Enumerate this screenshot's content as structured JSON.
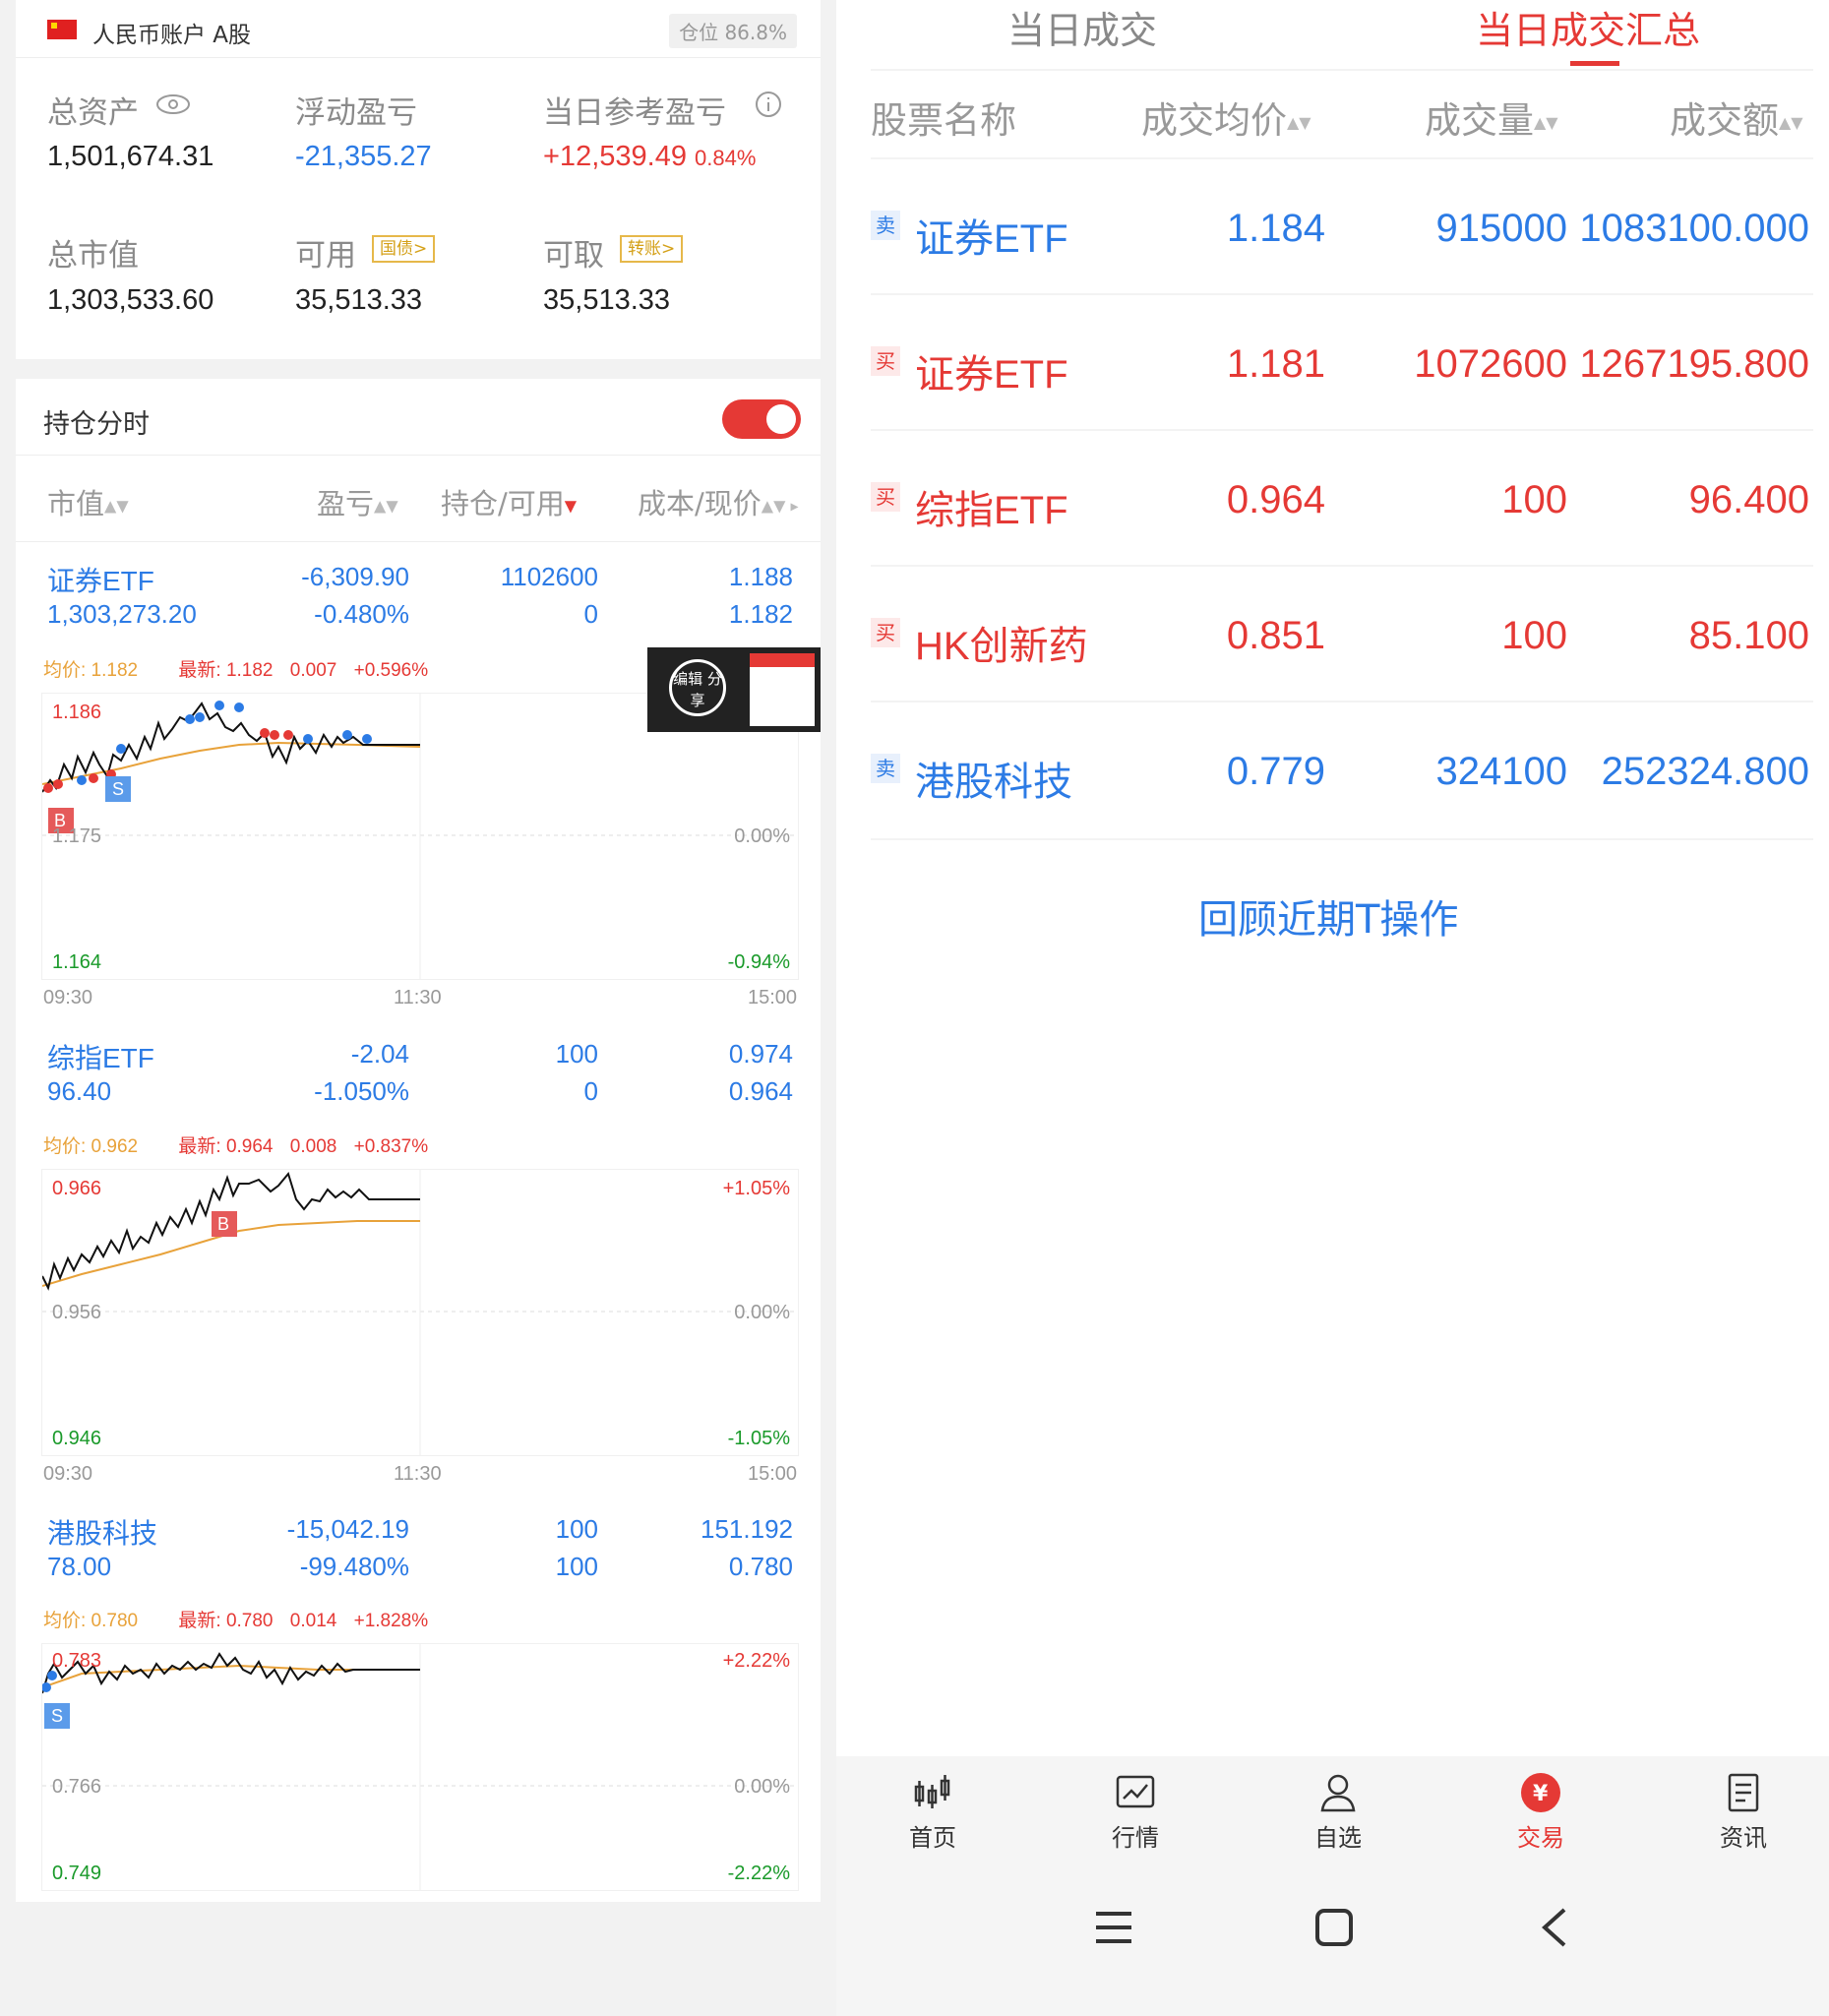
{
  "account": {
    "name": "人民币账户 A股",
    "position_label": "仓位 86.8%",
    "total_assets_label": "总资产",
    "total_assets": "1,501,674.31",
    "floating_pl_label": "浮动盈亏",
    "floating_pl": "-21,355.27",
    "daily_pl_label": "当日参考盈亏",
    "daily_pl": "+12,539.49",
    "daily_pl_pct": "0.84%",
    "market_value_label": "总市值",
    "market_value": "1,303,533.60",
    "available_label": "可用",
    "available_tag": "国债>",
    "available": "35,513.33",
    "withdrawable_label": "可取",
    "withdrawable_tag": "转账>",
    "withdrawable": "35,513.33"
  },
  "holdings_section": {
    "title": "持仓分时",
    "toggle_on": true,
    "headers": [
      "市值",
      "盈亏",
      "持仓/可用",
      "成本/现价"
    ]
  },
  "holdings": [
    {
      "name": "证券ETF",
      "market_value": "1,303,273.20",
      "pl": "-6,309.90",
      "pl_pct": "-0.480%",
      "position": "1102600",
      "available": "0",
      "cost": "1.188",
      "price": "1.182",
      "avg_label": "均价: 1.182",
      "last_label": "最新: 1.182",
      "change": "0.007",
      "change_pct": "+0.596%",
      "axis_top": "1.186",
      "axis_mid": "1.175",
      "axis_low": "1.164",
      "pct_top": "",
      "pct_mid": "0.00%",
      "pct_low": "-0.94%",
      "times": [
        "09:30",
        "11:30",
        "15:00"
      ]
    },
    {
      "name": "综指ETF",
      "market_value": "96.40",
      "pl": "-2.04",
      "pl_pct": "-1.050%",
      "position": "100",
      "available": "0",
      "cost": "0.974",
      "price": "0.964",
      "avg_label": "均价: 0.962",
      "last_label": "最新: 0.964",
      "change": "0.008",
      "change_pct": "+0.837%",
      "axis_top": "0.966",
      "axis_mid": "0.956",
      "axis_low": "0.946",
      "pct_top": "+1.05%",
      "pct_mid": "0.00%",
      "pct_low": "-1.05%",
      "times": [
        "09:30",
        "11:30",
        "15:00"
      ]
    },
    {
      "name": "港股科技",
      "market_value": "78.00",
      "pl": "-15,042.19",
      "pl_pct": "-99.480%",
      "position": "100",
      "available": "100",
      "cost": "151.192",
      "price": "0.780",
      "avg_label": "均价: 0.780",
      "last_label": "最新: 0.780",
      "change": "0.014",
      "change_pct": "+1.828%",
      "axis_top": "0.783",
      "axis_mid": "0.766",
      "axis_low": "0.749",
      "pct_top": "+2.22%",
      "pct_mid": "0.00%",
      "pct_low": "-2.22%",
      "times": []
    }
  ],
  "share_popup": {
    "text": "编辑 分享"
  },
  "trades_panel": {
    "tabs": [
      "当日成交",
      "当日成交汇总"
    ],
    "headers": [
      "股票名称",
      "成交均价",
      "成交量",
      "成交额"
    ],
    "rows": [
      {
        "side": "卖",
        "name": "证券ETF",
        "avg_price": "1.184",
        "volume": "915000",
        "amount": "1083100.000"
      },
      {
        "side": "买",
        "name": "证券ETF",
        "avg_price": "1.181",
        "volume": "1072600",
        "amount": "1267195.800"
      },
      {
        "side": "买",
        "name": "综指ETF",
        "avg_price": "0.964",
        "volume": "100",
        "amount": "96.400"
      },
      {
        "side": "买",
        "name": "HK创新药",
        "avg_price": "0.851",
        "volume": "100",
        "amount": "85.100"
      },
      {
        "side": "卖",
        "name": "港股科技",
        "avg_price": "0.779",
        "volume": "324100",
        "amount": "252324.800"
      }
    ],
    "review_link": "回顾近期T操作"
  },
  "bottom_nav": [
    {
      "label": "首页",
      "icon": "candlestick-icon"
    },
    {
      "label": "行情",
      "icon": "chart-icon"
    },
    {
      "label": "自选",
      "icon": "person-icon"
    },
    {
      "label": "交易",
      "icon": "yuan-icon",
      "active": true
    },
    {
      "label": "资讯",
      "icon": "document-icon"
    }
  ],
  "colors": {
    "up": "#e53935",
    "down": "#2c7be5",
    "avg_line": "#e8a23a",
    "accent": "#e53935"
  }
}
